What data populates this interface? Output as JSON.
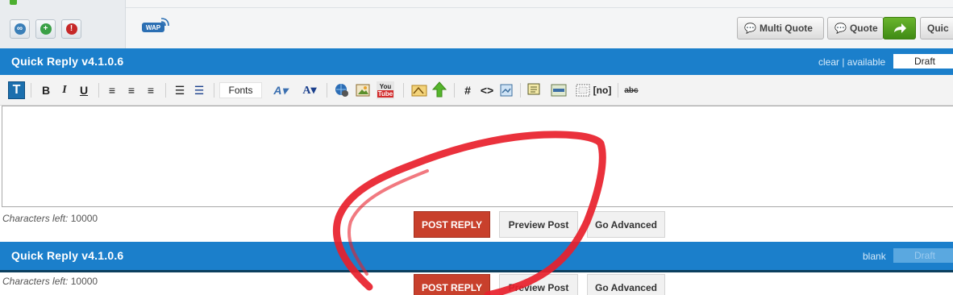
{
  "topbar": {
    "wap_label": "WAP",
    "multi_quote_label": "Multi Quote",
    "quote_label": "Quote",
    "quick_label": "Quic"
  },
  "quick_reply": {
    "title": "Quick Reply  v4.1.0.6",
    "status": "clear | available",
    "draft_label": "Draft"
  },
  "toolbar": {
    "fonts_label": "Fonts",
    "bold": "B",
    "italic": "I",
    "underline": "U",
    "hash": "#",
    "code": "<>",
    "noparse": "[no]",
    "strike": "abc",
    "youtube_top": "You",
    "youtube_bottom": "Tube"
  },
  "editor": {
    "value": "",
    "chars_left_label": "Characters left:",
    "chars_left_value": "10000"
  },
  "buttons": {
    "post_reply": "POST REPLY",
    "preview_post": "Preview Post",
    "go_advanced": "Go Advanced"
  },
  "quick_reply_2": {
    "title": "Quick Reply  v4.1.0.6",
    "status": "blank",
    "draft_label": "Draft",
    "chars_left_label": "Characters left:",
    "chars_left_value": "10000"
  },
  "colors": {
    "bar_blue": "#1b7fcb",
    "post_red": "#c8402c",
    "reply_green": "#4f9e1e",
    "annotation_red": "#e8202b"
  }
}
